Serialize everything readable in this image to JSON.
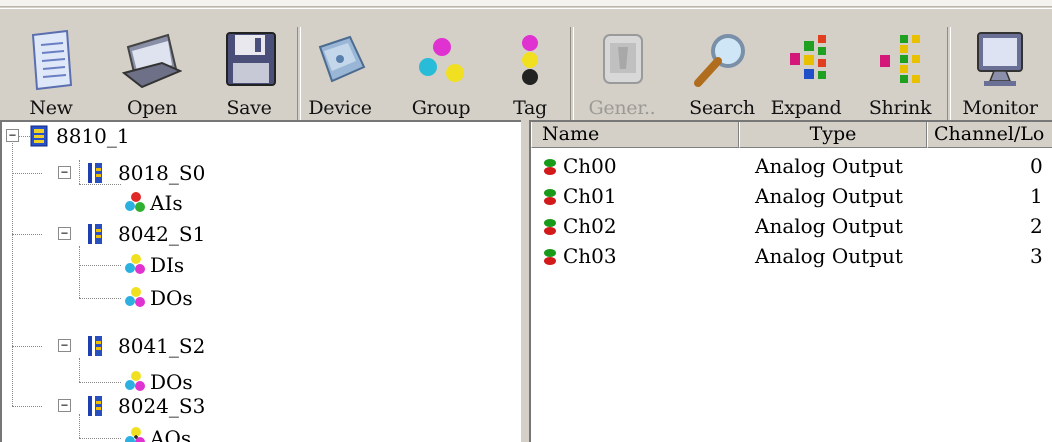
{
  "toolbar": {
    "buttons": [
      {
        "label": "New",
        "icon": "new-document-icon"
      },
      {
        "label": "Open",
        "icon": "open-icon"
      },
      {
        "label": "Save",
        "icon": "save-floppy-icon"
      },
      {
        "label": "Device",
        "icon": "device-icon"
      },
      {
        "label": "Group",
        "icon": "group-icon"
      },
      {
        "label": "Tag",
        "icon": "tag-icon"
      },
      {
        "label": "Gener..",
        "icon": "generate-icon",
        "disabled": true
      },
      {
        "label": "Search",
        "icon": "search-magnifier-icon"
      },
      {
        "label": "Expand",
        "icon": "expand-tree-icon"
      },
      {
        "label": "Shrink",
        "icon": "shrink-tree-icon"
      },
      {
        "label": "Monitor",
        "icon": "monitor-icon"
      }
    ]
  },
  "tree": {
    "root": {
      "label": "8810_1",
      "icon": "controller-icon"
    },
    "modules": [
      {
        "label": "8018_S0",
        "icon": "module-icon",
        "children": [
          {
            "label": "AIs",
            "icon": "group-icon"
          }
        ]
      },
      {
        "label": "8042_S1",
        "icon": "module-icon",
        "children": [
          {
            "label": "DIs",
            "icon": "group-icon"
          },
          {
            "label": "DOs",
            "icon": "group-icon"
          }
        ]
      },
      {
        "label": "8041_S2",
        "icon": "module-icon",
        "children": [
          {
            "label": "DOs",
            "icon": "group-icon"
          }
        ]
      },
      {
        "label": "8024_S3",
        "icon": "module-icon",
        "children": [
          {
            "label": "AOs",
            "icon": "group-icon"
          }
        ]
      }
    ]
  },
  "list": {
    "columns": [
      "Name",
      "Type",
      "Channel/Lo"
    ],
    "rows": [
      {
        "name": "Ch00",
        "type": "Analog Output",
        "channel": "0"
      },
      {
        "name": "Ch01",
        "type": "Analog Output",
        "channel": "1"
      },
      {
        "name": "Ch02",
        "type": "Analog Output",
        "channel": "2"
      },
      {
        "name": "Ch03",
        "type": "Analog Output",
        "channel": "3"
      }
    ]
  },
  "colors": {
    "tag_green": "#1a9a1a",
    "tag_red": "#d21a1a"
  }
}
